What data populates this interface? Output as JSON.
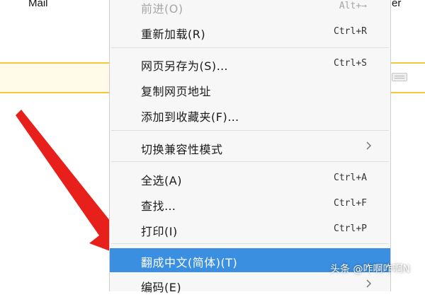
{
  "background": {
    "link_mail": "Mail",
    "link_right_fragment": "er"
  },
  "context_menu": {
    "items": [
      {
        "label": "前进(O)",
        "shortcut": "Alt+→",
        "disabled": true
      },
      {
        "label": "重新加载(R)",
        "shortcut": "Ctrl+R"
      },
      {
        "label": "网页另存为(S)…",
        "shortcut": "Ctrl+S"
      },
      {
        "label": "复制网页地址",
        "shortcut": ""
      },
      {
        "label": "添加到收藏夹(F)…",
        "shortcut": ""
      },
      {
        "label": "切换兼容性模式",
        "shortcut": "",
        "submenu": true
      },
      {
        "label": "全选(A)",
        "shortcut": "Ctrl+A"
      },
      {
        "label": "查找…",
        "shortcut": "Ctrl+F"
      },
      {
        "label": "打印(I)",
        "shortcut": "Ctrl+P"
      },
      {
        "label": "翻成中文(简体)(T)",
        "shortcut": "",
        "highlighted": true
      },
      {
        "label": "编码(E)",
        "shortcut": "",
        "submenu": true,
        "partially_visible": true
      }
    ]
  },
  "annotation": {
    "arrow_color": "#e8201c"
  },
  "watermark": {
    "text": "头条 @咋啊咋啊N"
  },
  "colors": {
    "highlight": "#3b8fe0",
    "search_border": "#f5c73a"
  }
}
